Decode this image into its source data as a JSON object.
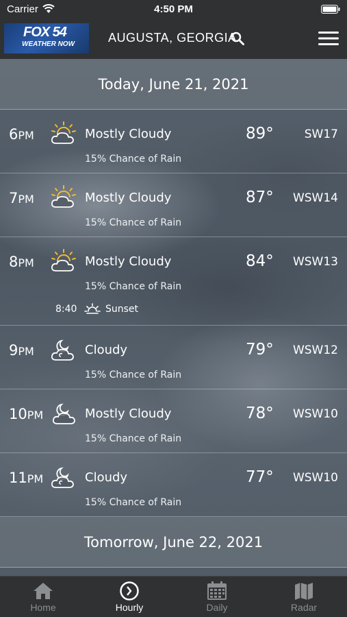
{
  "status_bar": {
    "carrier": "Carrier",
    "time": "4:50 PM"
  },
  "header": {
    "logo_main": "FOX 54",
    "logo_sub": "WEATHER NOW",
    "location": "AUGUSTA, GEORGIA",
    "icons": {
      "search": "search-icon",
      "menu": "hamburger-menu-icon"
    }
  },
  "today_header": "Today, June 21, 2021",
  "hours": [
    {
      "hour": "6",
      "ampm": "PM",
      "icon": "partly-cloudy-sun-icon",
      "condition": "Mostly Cloudy",
      "temp": "89°",
      "wind": "SW17",
      "rain": "15% Chance of Rain"
    },
    {
      "hour": "7",
      "ampm": "PM",
      "icon": "partly-cloudy-sun-icon",
      "condition": "Mostly Cloudy",
      "temp": "87°",
      "wind": "WSW14",
      "rain": "15% Chance of Rain"
    },
    {
      "hour": "8",
      "ampm": "PM",
      "icon": "partly-cloudy-sun-icon",
      "condition": "Mostly Cloudy",
      "temp": "84°",
      "wind": "WSW13",
      "rain": "15% Chance of Rain",
      "sunset_time": "8:40",
      "sunset_label": "Sunset"
    },
    {
      "hour": "9",
      "ampm": "PM",
      "icon": "cloudy-night-icon",
      "condition": "Cloudy",
      "temp": "79°",
      "wind": "WSW12",
      "rain": "15% Chance of Rain"
    },
    {
      "hour": "10",
      "ampm": "PM",
      "icon": "mostly-cloudy-night-icon",
      "condition": "Mostly Cloudy",
      "temp": "78°",
      "wind": "WSW10",
      "rain": "15% Chance of Rain"
    },
    {
      "hour": "11",
      "ampm": "PM",
      "icon": "cloudy-night-icon",
      "condition": "Cloudy",
      "temp": "77°",
      "wind": "WSW10",
      "rain": "15% Chance of Rain"
    }
  ],
  "tomorrow_header": "Tomorrow, June 22, 2021",
  "tabs": [
    {
      "label": "Home",
      "icon": "home-icon",
      "active": false
    },
    {
      "label": "Hourly",
      "icon": "clock-icon",
      "active": true
    },
    {
      "label": "Daily",
      "icon": "calendar-icon",
      "active": false
    },
    {
      "label": "Radar",
      "icon": "map-icon",
      "active": false
    }
  ]
}
